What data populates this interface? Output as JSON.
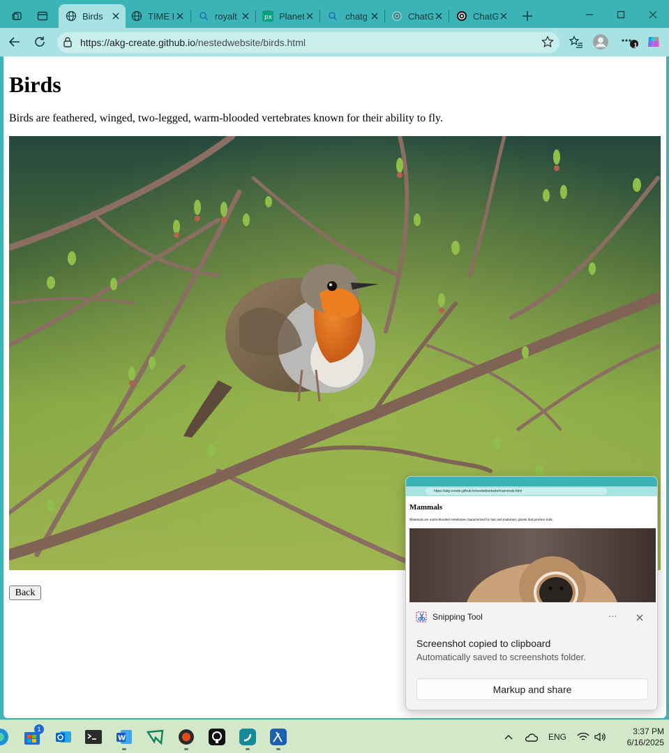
{
  "browser": {
    "tabs": [
      {
        "label": "Birds",
        "icon": "globe-icon",
        "active": true
      },
      {
        "label": "TIME I",
        "icon": "globe-icon",
        "active": false
      },
      {
        "label": "royalt",
        "icon": "search-icon",
        "active": false
      },
      {
        "label": "Planet",
        "icon": "pexels-icon",
        "active": false
      },
      {
        "label": "chatg",
        "icon": "search-icon",
        "active": false
      },
      {
        "label": "ChatG",
        "icon": "openai-icon",
        "active": false
      },
      {
        "label": "ChatG",
        "icon": "openai-icon",
        "active": false
      }
    ],
    "address": {
      "url_host": "https://akg-create.github.io",
      "url_path": "/nestedwebsite/birds.html"
    },
    "notification_count": "1"
  },
  "page": {
    "title": "Birds",
    "description": "Birds are feathered, winged, two-legged, warm-blooded vertebrates known for their ability to fly.",
    "image_subject": "European robin perched on a budding branch",
    "back_label": "Back"
  },
  "toast": {
    "app_name": "Snipping Tool",
    "more_label": "···",
    "message": "Screenshot copied to clipboard",
    "sub_message": "Automatically saved to screenshots folder.",
    "action_label": "Markup and share",
    "preview": {
      "url": "https://akg-create.github.io/nestedwebsite/mammals.html",
      "title": "Mammals",
      "description": "Mammals are warm-blooded vertebrates characterized by hair and mammary glands that produce milk."
    }
  },
  "taskbar": {
    "store_badge": "1",
    "language": "ENG",
    "time": "3:37 PM",
    "date": "6/16/2025"
  },
  "colors": {
    "frame": "#3cb3b6",
    "toolbar": "#a8e2e2",
    "taskbar": "#d3e8c8"
  }
}
